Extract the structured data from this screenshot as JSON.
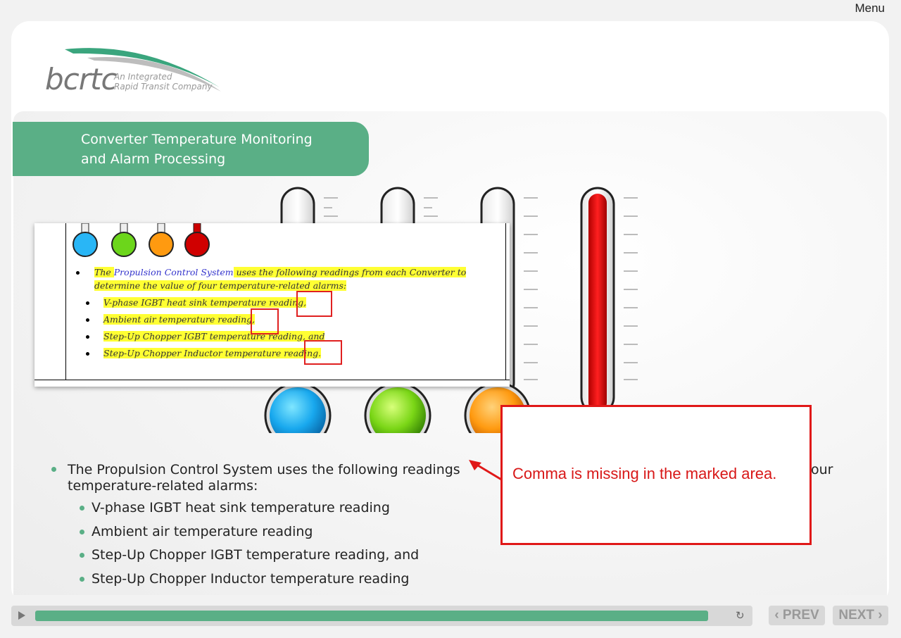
{
  "header": {
    "menu_label": "Menu"
  },
  "logo": {
    "wordmark": "bcrtc",
    "tagline": "An Integrated\nRapid Transit Company",
    "accent": "#3aa57d"
  },
  "slide": {
    "title": "Converter Temperature Monitoring\nand Alarm Processing",
    "accent": "#5aaf86",
    "bullet_main": "The Propulsion Control System uses the following readings from each Converter to determine the value of four\ntemperature-related alarms:",
    "bullet_main_visible_pre": "The Propulsion Control System uses the following readings ",
    "bullet_main_visible_end": "our",
    "sub_bullets": [
      "V-phase IGBT heat sink temperature reading",
      "Ambient air temperature reading",
      "Step-Up Chopper IGBT temperature reading, and",
      "Step-Up Chopper Inductor temperature reading"
    ]
  },
  "document_excerpt": {
    "intro_1": "The ",
    "intro_link": "Propulsion Control System",
    "intro_2": " uses the following readings from each Converter to",
    "intro_3": "determine the value of four temperature-related alarms:",
    "items": [
      "V-phase IGBT heat sink temperature reading,",
      "Ambient air temperature reading,",
      "Step-Up Chopper IGBT temperature reading, and",
      "Step-Up Chopper Inductor temperature reading."
    ]
  },
  "review_callout": {
    "text": "Comma is missing in the marked area.",
    "color": "#d81818"
  },
  "player": {
    "progress": 0.94,
    "prev_label": "‹ PREV",
    "next_label": "NEXT ›"
  },
  "thermometers": [
    {
      "color": "blue",
      "level": 0.0
    },
    {
      "color": "green",
      "level": 0.0
    },
    {
      "color": "orange",
      "level": 0.0
    },
    {
      "color": "red",
      "level": 1.0
    }
  ]
}
